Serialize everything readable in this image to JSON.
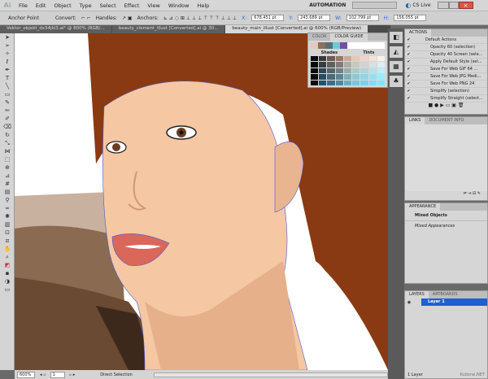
{
  "menu": {
    "logo": "Ai",
    "items": [
      "File",
      "Edit",
      "Object",
      "Type",
      "Select",
      "Effect",
      "View",
      "Window",
      "Help"
    ],
    "workspace": "AUTOMATION",
    "search_placeholder": "",
    "cslive": "CS Live"
  },
  "control": {
    "anchor_point": "Anchor Point",
    "convert": "Convert:",
    "handles": "Handles:",
    "anchors": "Anchors:",
    "x_label": "X:",
    "x": "678.451 pt",
    "y_label": "Y:",
    "y": "243.689 pt",
    "w_label": "W:",
    "w": "102.799 pt",
    "h_label": "H:",
    "h": "156.055 pt"
  },
  "tabs": [
    {
      "label": "Vektor_objekt_dx34jkl3.ai* @ 800% (RGB/..."
    },
    {
      "label": "beauty_clement_illust [Converted].ai @ 30..."
    },
    {
      "label": "beauty_main_illust [Converted].ai @ 600% (RGB/Preview)",
      "active": true
    }
  ],
  "color_guide": {
    "tabs": [
      "COLOR",
      "COLOR GUIDE"
    ],
    "shades": "Shades",
    "tints": "Tints",
    "harmony": [
      "#e8c8b8",
      "#8a7060",
      "#5a7070",
      "#70c8d8",
      "#7050a0"
    ]
  },
  "actions": {
    "title": "ACTIONS",
    "items": [
      {
        "name": "Default Actions",
        "folder": true
      },
      {
        "name": "Opacity 60 (selection)"
      },
      {
        "name": "Opacity 40 Screen (sele..."
      },
      {
        "name": "Apply Default Style (sel..."
      },
      {
        "name": "Save For Web GIF 64 ..."
      },
      {
        "name": "Save For Web JPG Medi..."
      },
      {
        "name": "Save For Web PNG 24"
      },
      {
        "name": "Simplify (selection)"
      },
      {
        "name": "Simplify Straight (select..."
      }
    ]
  },
  "links": {
    "tabs": [
      "LINKS",
      "DOCUMENT INFO"
    ]
  },
  "appearance": {
    "title": "APPEARANCE",
    "object": "Mixed Objects",
    "sub": "Mixed Appearances"
  },
  "layers": {
    "tabs": [
      "LAYERS",
      "ARTBOARDS"
    ],
    "layer": "Layer 1",
    "count": "1 Layer",
    "watermark": "Kuborai.NET"
  },
  "status": {
    "zoom": "600%",
    "artboard": "1",
    "tool": "Direct Selection"
  },
  "colors": {
    "skin": "#f5c7a3",
    "hair": "#8a3a12",
    "selection": "#4a5ad8",
    "layer_highlight": "#1f5fd0"
  }
}
